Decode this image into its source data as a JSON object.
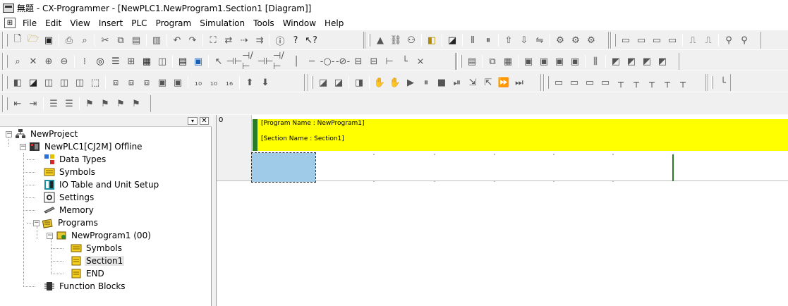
{
  "window": {
    "title": "無題 - CX-Programmer - [NewPLC1.NewProgram1.Section1 [Diagram]]"
  },
  "menu": {
    "items": [
      "File",
      "Edit",
      "View",
      "Insert",
      "PLC",
      "Program",
      "Simulation",
      "Tools",
      "Window",
      "Help"
    ]
  },
  "tree": {
    "project": "NewProject",
    "plc": "NewPLC1[CJ2M] Offline",
    "data_types": "Data Types",
    "symbols": "Symbols",
    "io_table": "IO Table and Unit Setup",
    "settings": "Settings",
    "memory": "Memory",
    "programs": "Programs",
    "program": "NewProgram1 (00)",
    "program_symbols": "Symbols",
    "section": "Section1",
    "end": "END",
    "function_blocks": "Function Blocks"
  },
  "diagram": {
    "rung_number": "0",
    "program_name_comment": "[Program Name : NewProgram1]",
    "section_name_comment": "[Section Name : Section1]"
  },
  "colors": {
    "comment_bg": "#ffff00",
    "rung_bar": "#2a7b2a",
    "cursor": "#9fcbe8"
  }
}
